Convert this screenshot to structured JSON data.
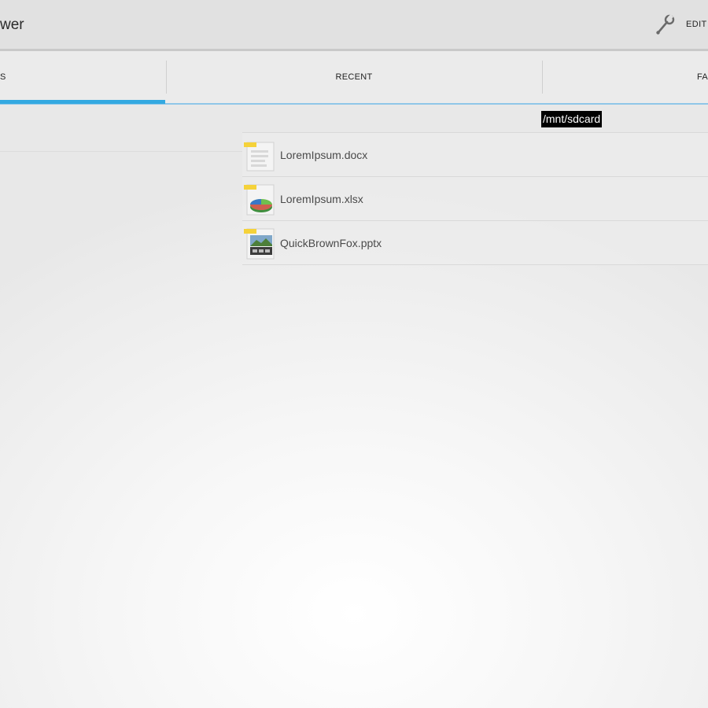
{
  "app": {
    "title": "wer"
  },
  "toolbar": {
    "edit_label": "EDIT",
    "edit_icon": "wrench-icon"
  },
  "tabs": [
    {
      "label": "S",
      "active": true
    },
    {
      "label": "RECENT",
      "active": false
    },
    {
      "label": "FA",
      "active": false
    }
  ],
  "path": "/mnt/sdcard",
  "files": [
    {
      "name": "LoremIpsum.docx",
      "icon": "docx-file-icon"
    },
    {
      "name": "LoremIpsum.xlsx",
      "icon": "xlsx-file-icon"
    },
    {
      "name": "QuickBrownFox.pptx",
      "icon": "pptx-file-icon"
    }
  ],
  "colors": {
    "accent": "#33a9e1",
    "action_bar": "#e1e1e1",
    "tab_strip": "#ebebeb"
  }
}
